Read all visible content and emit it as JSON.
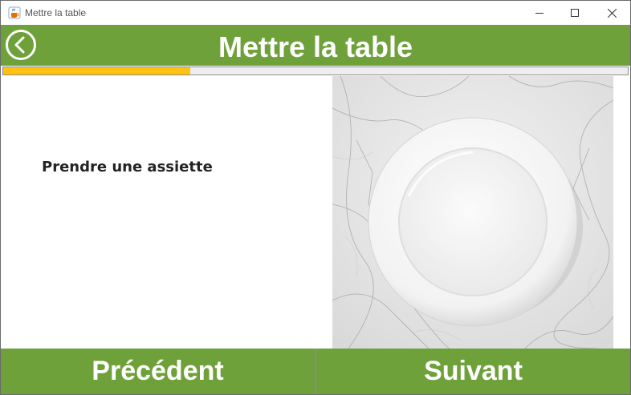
{
  "window": {
    "title": "Mettre la table"
  },
  "header": {
    "title": "Mettre la table"
  },
  "progress": {
    "value": 0.3
  },
  "step": {
    "instruction": "Prendre une assiette",
    "image": "white-plate-on-marble-photo"
  },
  "footer": {
    "previous_label": "Précédent",
    "next_label": "Suivant"
  },
  "colors": {
    "accent_green": "#6ea13a",
    "progress_yellow": "#ffc20e",
    "progress_track": "#eeeeee"
  },
  "icons": {
    "app": "java-cup-icon",
    "back": "back-arrow-circle-icon",
    "minimize": "minimize-icon",
    "maximize": "maximize-icon",
    "close": "close-icon"
  }
}
